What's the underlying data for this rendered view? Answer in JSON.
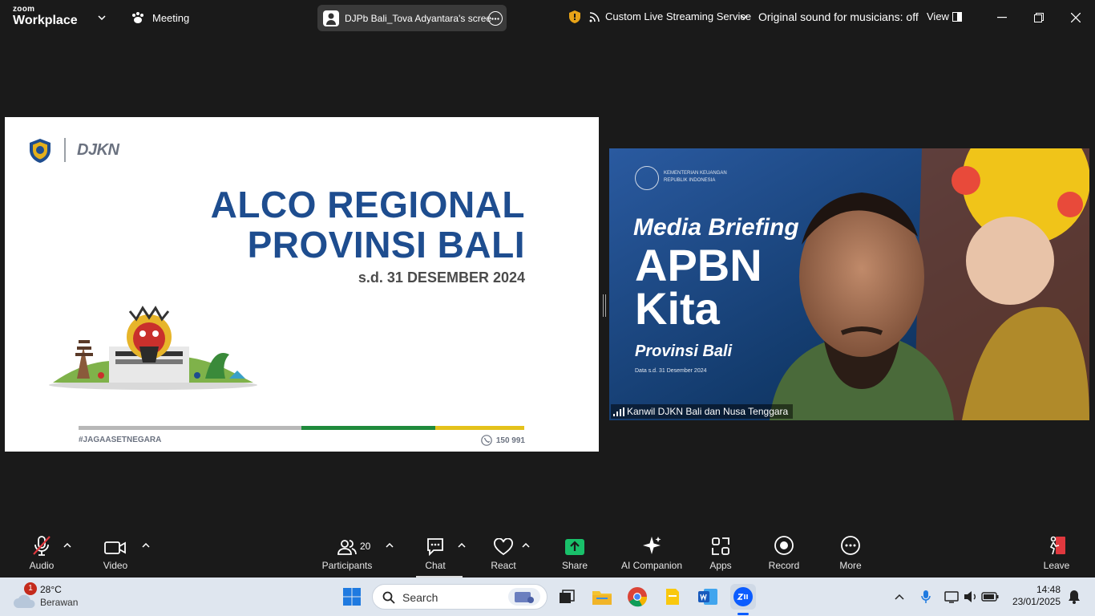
{
  "titlebar": {
    "brand_top": "zoom",
    "brand_bottom": "Workplace",
    "meeting_label": "Meeting",
    "share_label": "DJPb Bali_Tova Adyantara's scree",
    "streaming_label": "Custom Live Streaming Service",
    "original_sound_label": "Original sound for musicians: off",
    "view_label": "View"
  },
  "slide": {
    "brand": "DJKN",
    "title_line1": "ALCO REGIONAL",
    "title_line2": "PROVINSI BALI",
    "subtitle": "s.d. 31 DESEMBER 2024",
    "hashtag": "#JAGAASETNEGARA",
    "phone": "150 991",
    "bar_colors": [
      "#b8b8b8",
      "#1f8a3c",
      "#e4c21b"
    ]
  },
  "video": {
    "participant_name": "Kanwil DJKN Bali dan Nusa Tenggara",
    "bg_lines": [
      "Media Briefing",
      "APBN",
      "Kita",
      "Provinsi Bali",
      "Data s.d. 31 Desember 2024"
    ],
    "bg_header": [
      "KEMENTERIAN KEUANGAN",
      "REPUBLIK INDONESIA"
    ]
  },
  "toolbar": {
    "audio": "Audio",
    "video": "Video",
    "participants": "Participants",
    "participants_count": "20",
    "chat": "Chat",
    "react": "React",
    "share": "Share",
    "ai": "AI Companion",
    "apps": "Apps",
    "record": "Record",
    "more": "More",
    "leave": "Leave"
  },
  "taskbar": {
    "weather_badge": "1",
    "temperature": "28°C",
    "weather_desc": "Berawan",
    "search_label": "Search",
    "time": "14:48",
    "date": "23/01/2025"
  },
  "colors": {
    "slide_title": "#1e4d8f",
    "share_green": "#19c06a",
    "leave_red": "#e0383e"
  }
}
